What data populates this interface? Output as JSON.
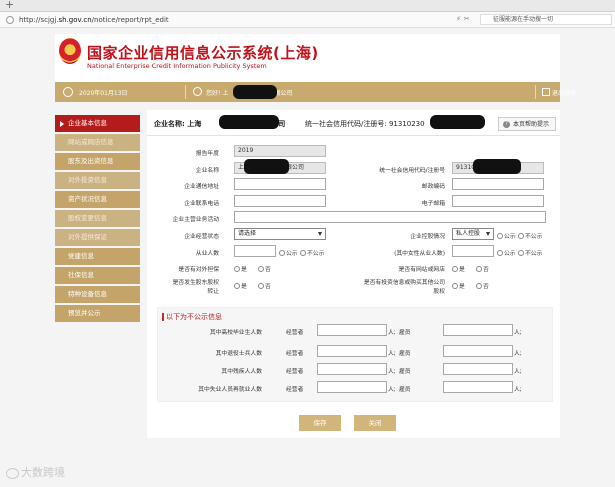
{
  "browser": {
    "new_tab": "+",
    "url_prefix": "http://scjgj.",
    "url_domain": "sh.gov.cn",
    "url_path": "/notice/report/rpt_edit",
    "search_text": "征服能源在手动搜一切"
  },
  "header": {
    "title_cn": "国家企业信用信息公示系统(上海)",
    "title_en": "National Enterprise Credit Information Publicity System"
  },
  "status_bar": {
    "date": "2020年01月13日",
    "welcome": "您好! 上",
    "welcome_tail": "有限公司",
    "logout": "退出登录"
  },
  "sidebar": {
    "items": [
      {
        "label": "企业基本信息"
      },
      {
        "label": "网站或网店信息"
      },
      {
        "label": "股东及出资信息"
      },
      {
        "label": "对外投资信息"
      },
      {
        "label": "资产状况信息"
      },
      {
        "label": "股权变更信息"
      },
      {
        "label": "对外提供保证"
      },
      {
        "label": "党建信息"
      },
      {
        "label": "社保信息"
      },
      {
        "label": "特种设备信息"
      },
      {
        "label": "预览并公示"
      }
    ]
  },
  "main": {
    "ent_label": "企业名称: 上海",
    "ent_tail": "有限公司",
    "code_label": "统一社会信用代码/注册号: 91310230",
    "help": "本页帮助提示",
    "form": {
      "report_year_label": "报告年度",
      "report_year": "2019",
      "name_label": "企业名称",
      "name_prefix": "上",
      "name_value": "有限公司",
      "code_label": "统一社会信用代码/注册号",
      "code_value": "913102",
      "addr_label": "企业通信地址",
      "zip_label": "邮政编码",
      "phone_label": "企业联系电话",
      "email_label": "电子邮箱",
      "business_label": "企业主营业务活动",
      "status_label": "企业经营状态",
      "status_value": "请选择",
      "holding_label": "企业控股情况",
      "holding_value": "私人控股",
      "employees_label": "从业人数",
      "female_label": "(其中女性从业人数)",
      "public": "公示",
      "not_public": "不公示",
      "guarantee_label": "是否有对外担保",
      "website_label": "是否有网站或网店",
      "equity_label_1": "是否发生股东股权",
      "equity_label_2": "转让",
      "invest_label_1": "是否有投资信息或购买其他公司",
      "invest_label_2": "股权",
      "yes": "是",
      "no": "否"
    },
    "undisclosed": {
      "title": "以下为不公示信息",
      "rows": [
        {
          "label": "其中高校毕业生人数"
        },
        {
          "label": "其中退役士兵人数"
        },
        {
          "label": "其中残疾人人数"
        },
        {
          "label": "其中失业人员再就业人数"
        }
      ],
      "operator": "经营者",
      "employee": "雇员",
      "unit": "人;"
    },
    "save": "保存",
    "close": "关闭"
  },
  "watermark": "大数跨境"
}
